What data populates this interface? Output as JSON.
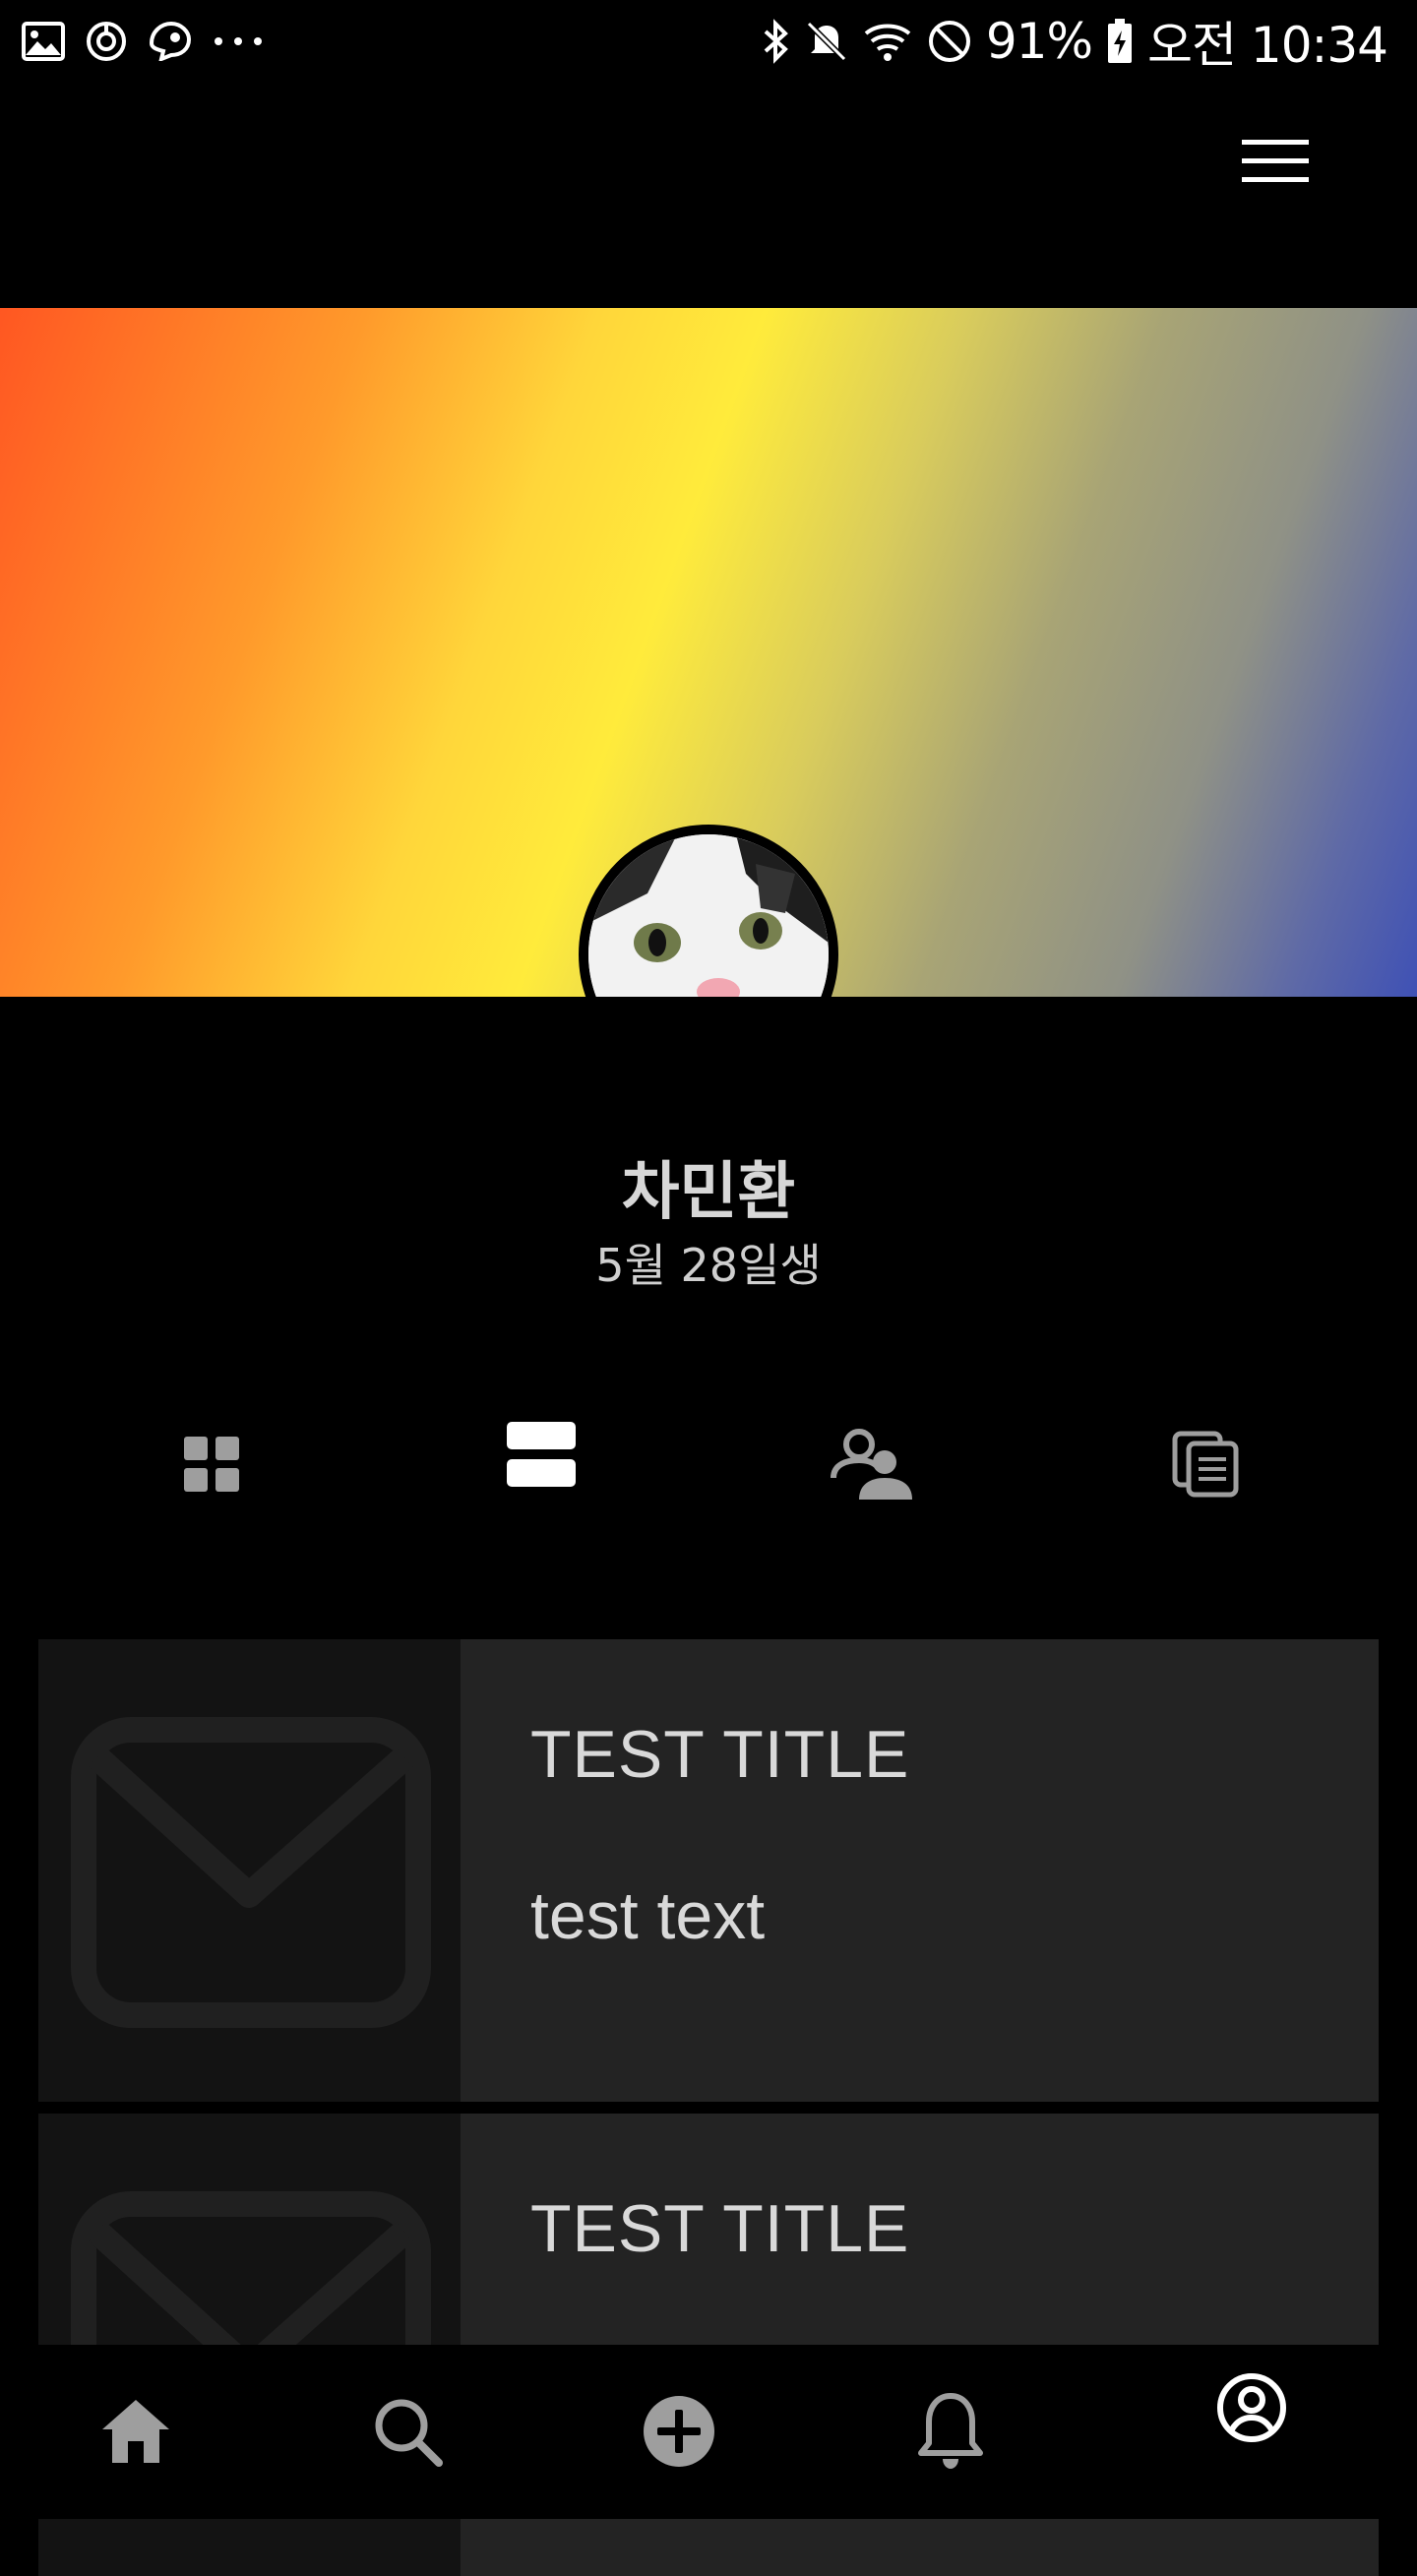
{
  "status_bar": {
    "notification_icons": [
      "gallery-icon",
      "sync-icon",
      "steam-icon",
      "more-dots-icon"
    ],
    "system_icons": [
      "bluetooth-icon",
      "mute-icon",
      "wifi-icon",
      "do-not-disturb-icon"
    ],
    "battery_percent": "91%",
    "battery_icon": "battery-charging-icon",
    "time": "오전 10:34"
  },
  "app_bar": {
    "menu_icon": "hamburger-menu-icon"
  },
  "colors": {
    "background": "#000000",
    "cover_gradient": [
      "#ff5722",
      "#ffb52a",
      "#ffeb3b",
      "#8f9186",
      "#3f51b5"
    ],
    "card_background": "#232323",
    "card_thumb_background": "#131313",
    "tab_active": "#ffffff",
    "tab_inactive": "#9e9e9e"
  },
  "profile": {
    "avatar": "cat-avatar",
    "name": "차민환",
    "birthday": "5월 28일생"
  },
  "view_tabs": [
    {
      "icon": "grid-view-icon",
      "active": false
    },
    {
      "icon": "list-view-icon",
      "active": true
    },
    {
      "icon": "people-icon",
      "active": false
    },
    {
      "icon": "documents-icon",
      "active": false
    }
  ],
  "posts": [
    {
      "thumb_icon": "mail-icon",
      "title": "TEST TITLE",
      "text": "test text"
    },
    {
      "thumb_icon": "mail-icon",
      "title": "TEST TITLE",
      "text": ""
    }
  ],
  "bottom_nav": [
    {
      "icon": "home-icon",
      "active": false
    },
    {
      "icon": "search-icon",
      "active": false
    },
    {
      "icon": "add-circle-icon",
      "active": false
    },
    {
      "icon": "bell-icon",
      "active": false
    },
    {
      "icon": "account-circle-icon",
      "active": true
    }
  ]
}
